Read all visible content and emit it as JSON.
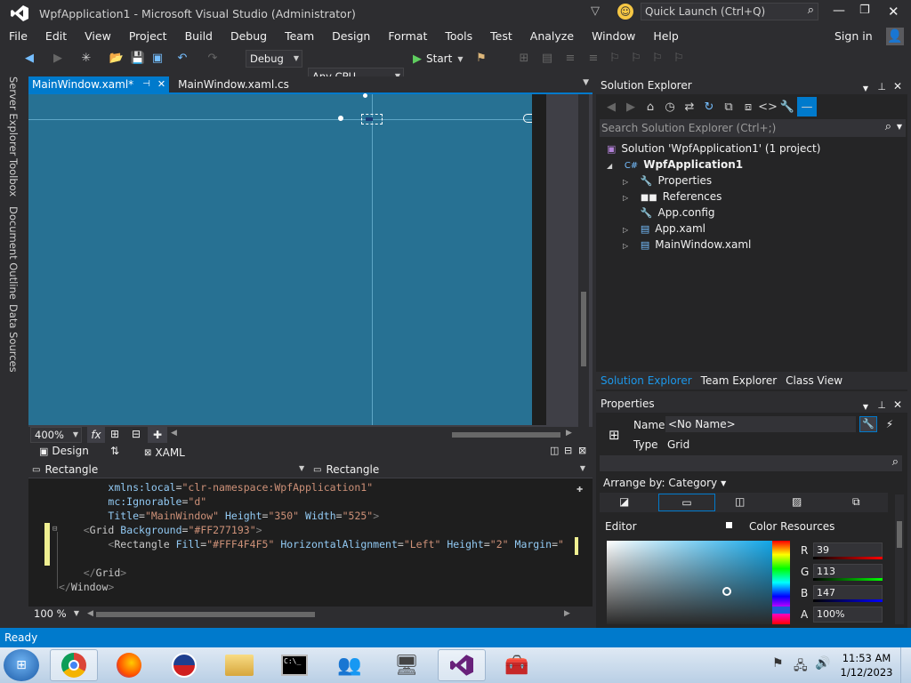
{
  "window": {
    "title": "WpfApplication1 - Microsoft Visual Studio (Administrator)",
    "quick_launch_placeholder": "Quick Launch (Ctrl+Q)",
    "sign_in": "Sign in"
  },
  "menu": [
    "File",
    "Edit",
    "View",
    "Project",
    "Build",
    "Debug",
    "Team",
    "Design",
    "Format",
    "Tools",
    "Test",
    "Analyze",
    "Window",
    "Help"
  ],
  "toolbar": {
    "config": "Debug",
    "platform": "Any CPU",
    "start": "Start"
  },
  "left_rail": [
    "Server Explorer",
    "Toolbox",
    "Document Outline",
    "Data Sources"
  ],
  "doc_tabs": [
    {
      "label": "MainWindow.xaml*",
      "active": true
    },
    {
      "label": "MainWindow.xaml.cs",
      "active": false
    }
  ],
  "designer": {
    "canvas_color": "#277193",
    "zoom": "400%",
    "fx": "fx",
    "design_tab": "Design",
    "xaml_tab": "XAML"
  },
  "breadcrumbs": {
    "left": "Rectangle",
    "right": "Rectangle"
  },
  "code": {
    "lines": [
      {
        "indent": "        ",
        "parts": [
          [
            "attr",
            "xmlns:local"
          ],
          [
            "str",
            "="
          ],
          [
            "val",
            "\"clr-namespace:WpfApplication1\""
          ]
        ]
      },
      {
        "indent": "        ",
        "parts": [
          [
            "attr",
            "mc:Ignorable"
          ],
          [
            "str",
            "="
          ],
          [
            "val",
            "\"d\""
          ]
        ]
      },
      {
        "indent": "        ",
        "parts": [
          [
            "attr",
            "Title"
          ],
          [
            "str",
            "="
          ],
          [
            "val",
            "\"MainWindow\""
          ],
          [
            "str",
            " "
          ],
          [
            "attr",
            "Height"
          ],
          [
            "str",
            "="
          ],
          [
            "val",
            "\"350\""
          ],
          [
            "str",
            " "
          ],
          [
            "attr",
            "Width"
          ],
          [
            "str",
            "="
          ],
          [
            "val",
            "\"525\""
          ],
          [
            "gray",
            ">"
          ]
        ]
      },
      {
        "indent": "    ",
        "parts": [
          [
            "gray",
            "<"
          ],
          [
            "str",
            "Grid"
          ],
          [
            "str",
            " "
          ],
          [
            "attr",
            "Background"
          ],
          [
            "str",
            "="
          ],
          [
            "val",
            "\"#FF277193\""
          ],
          [
            "gray",
            ">"
          ]
        ]
      },
      {
        "indent": "        ",
        "parts": [
          [
            "gray",
            "<"
          ],
          [
            "str",
            "Rectangle"
          ],
          [
            "str",
            " "
          ],
          [
            "attr",
            "Fill"
          ],
          [
            "str",
            "="
          ],
          [
            "val",
            "\"#FFF4F4F5\""
          ],
          [
            "str",
            " "
          ],
          [
            "attr",
            "HorizontalAlignment"
          ],
          [
            "str",
            "="
          ],
          [
            "val",
            "\"Left\""
          ],
          [
            "str",
            " "
          ],
          [
            "attr",
            "Height"
          ],
          [
            "str",
            "="
          ],
          [
            "val",
            "\"2\""
          ],
          [
            "str",
            " "
          ],
          [
            "attr",
            "Margin"
          ],
          [
            "str",
            "="
          ],
          [
            "val",
            "\""
          ]
        ]
      },
      {
        "indent": "",
        "parts": []
      },
      {
        "indent": "    ",
        "parts": [
          [
            "gray",
            "</"
          ],
          [
            "str",
            "Grid"
          ],
          [
            "gray",
            ">"
          ]
        ]
      },
      {
        "indent": "",
        "parts": [
          [
            "gray",
            "</"
          ],
          [
            "str",
            "Window"
          ],
          [
            "gray",
            ">"
          ]
        ]
      }
    ],
    "zoom": "100 %"
  },
  "solution_explorer": {
    "title": "Solution Explorer",
    "search_placeholder": "Search Solution Explorer (Ctrl+;)",
    "solution": "Solution 'WpfApplication1' (1 project)",
    "project": "WpfApplication1",
    "items": [
      "Properties",
      "References",
      "App.config",
      "App.xaml",
      "MainWindow.xaml"
    ],
    "bottom_tabs": [
      "Solution Explorer",
      "Team Explorer",
      "Class View"
    ]
  },
  "properties": {
    "title": "Properties",
    "name_label": "Name",
    "name_value": "<No Name>",
    "type_label": "Type",
    "type_value": "Grid",
    "arrange_by": "Arrange by: Category",
    "editor_label": "Editor",
    "color_resources": "Color Resources",
    "rgba": [
      {
        "label": "R",
        "value": "39"
      },
      {
        "label": "G",
        "value": "113"
      },
      {
        "label": "B",
        "value": "147"
      },
      {
        "label": "A",
        "value": "100%"
      }
    ]
  },
  "status": {
    "text": "Ready"
  },
  "taskbar": {
    "time": "11:53 AM",
    "date": "1/12/2023"
  }
}
